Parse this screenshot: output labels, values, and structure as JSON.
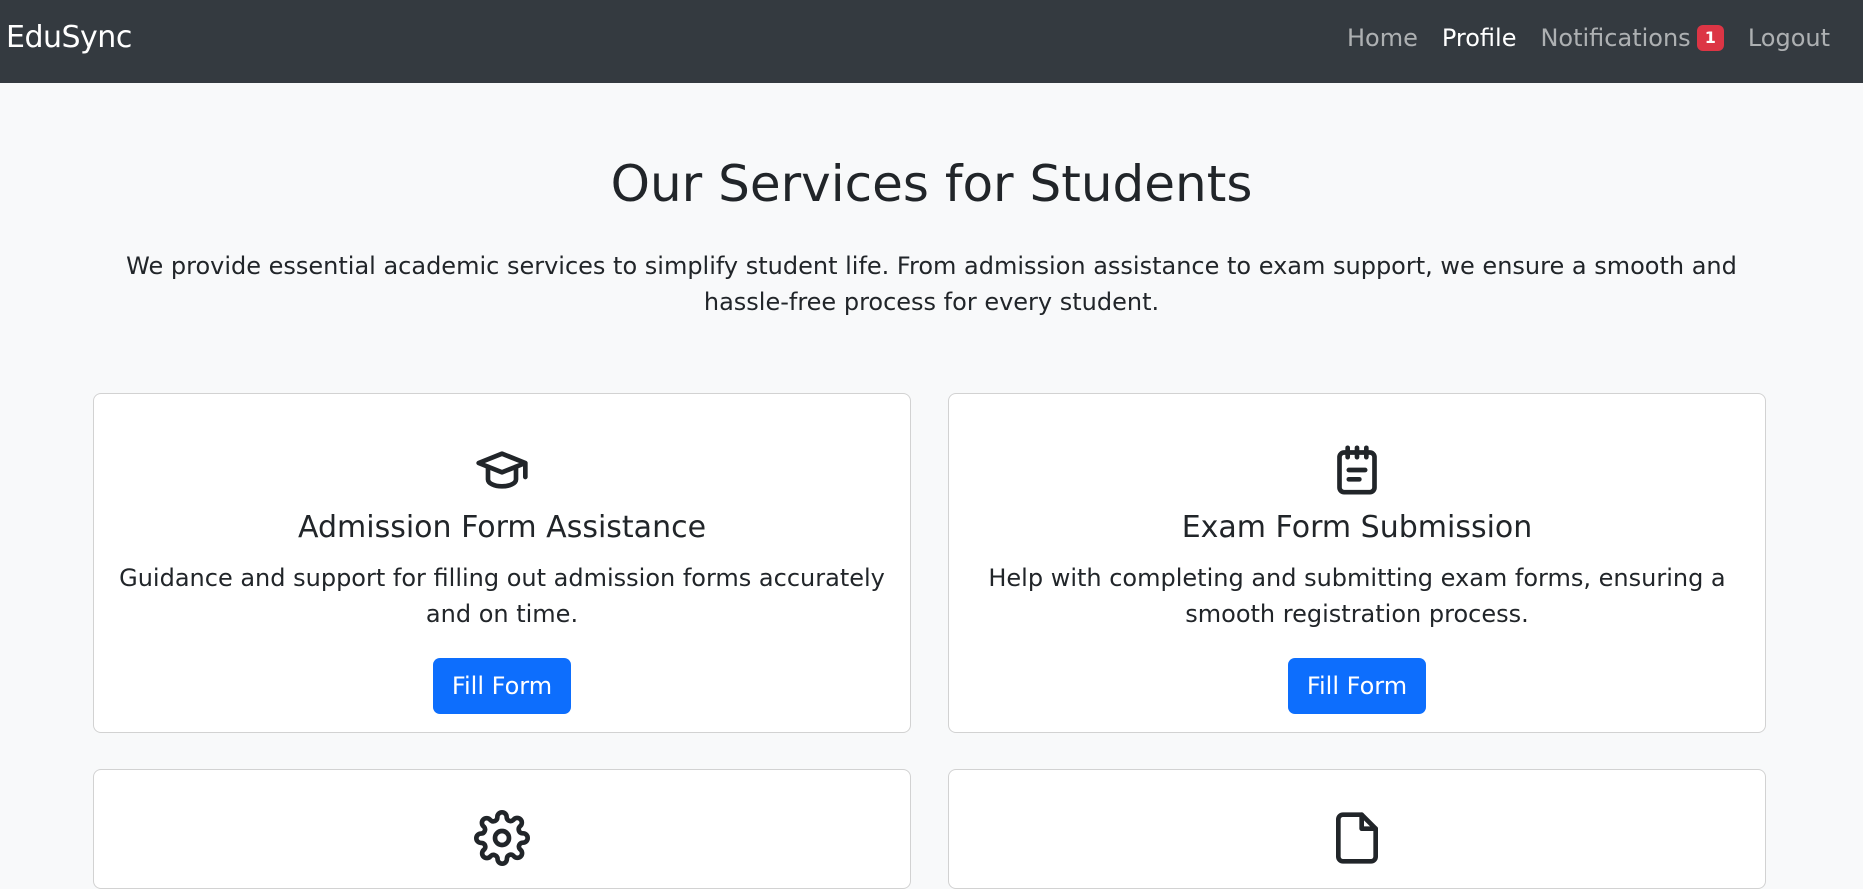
{
  "navbar": {
    "brand": "EduSync",
    "links": [
      {
        "label": "Home"
      },
      {
        "label": "Profile"
      },
      {
        "label": "Notifications",
        "badge": "1"
      },
      {
        "label": "Logout"
      }
    ]
  },
  "hero": {
    "title": "Our Services for Students",
    "subtitle": "We provide essential academic services to simplify student life. From admission assistance to exam support, we ensure a smooth and hassle-free process for every student."
  },
  "services": [
    {
      "icon": "graduation-cap-icon",
      "title": "Admission Form Assistance",
      "description": "Guidance and support for filling out admission forms accurately and on time.",
      "button": "Fill Form"
    },
    {
      "icon": "notepad-icon",
      "title": "Exam Form Submission",
      "description": "Help with completing and submitting exam forms, ensuring a smooth registration process.",
      "button": "Fill Form"
    },
    {
      "icon": "gear-icon"
    },
    {
      "icon": "document-icon"
    }
  ],
  "colors": {
    "navbar": "#343a40",
    "primary": "#0d6efd",
    "badge": "#dc3545",
    "background": "#f8f9fa"
  }
}
